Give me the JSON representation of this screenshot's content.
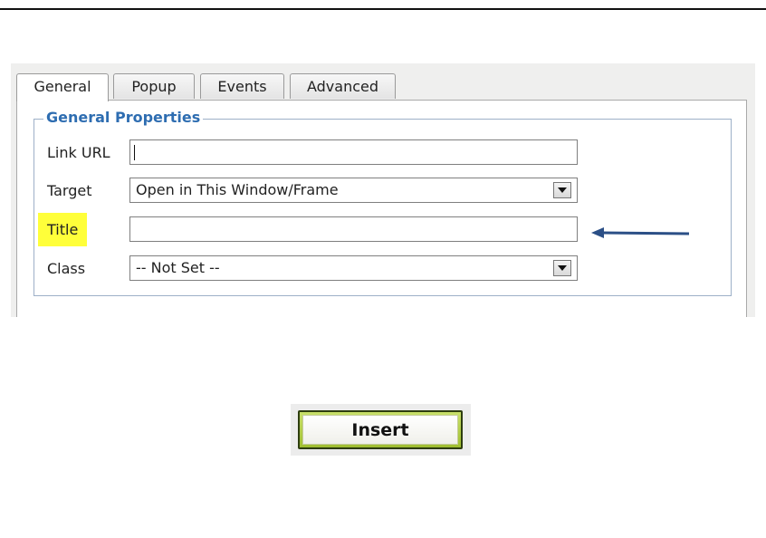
{
  "tabs": [
    {
      "label": "General",
      "active": true
    },
    {
      "label": "Popup",
      "active": false
    },
    {
      "label": "Events",
      "active": false
    },
    {
      "label": "Advanced",
      "active": false
    }
  ],
  "section": {
    "legend": "General Properties"
  },
  "fields": {
    "link_url": {
      "label": "Link URL",
      "value": ""
    },
    "target": {
      "label": "Target",
      "value": "Open in This Window/Frame"
    },
    "title": {
      "label": "Title",
      "value": ""
    },
    "class": {
      "label": "Class",
      "value": "-- Not Set --"
    }
  },
  "insert_button": {
    "label": "Insert"
  },
  "colors": {
    "legend": "#2e6db1",
    "title_highlight": "#ffff3a",
    "arrow": "#2b4f86",
    "insert_border": "#9fbe2f"
  }
}
